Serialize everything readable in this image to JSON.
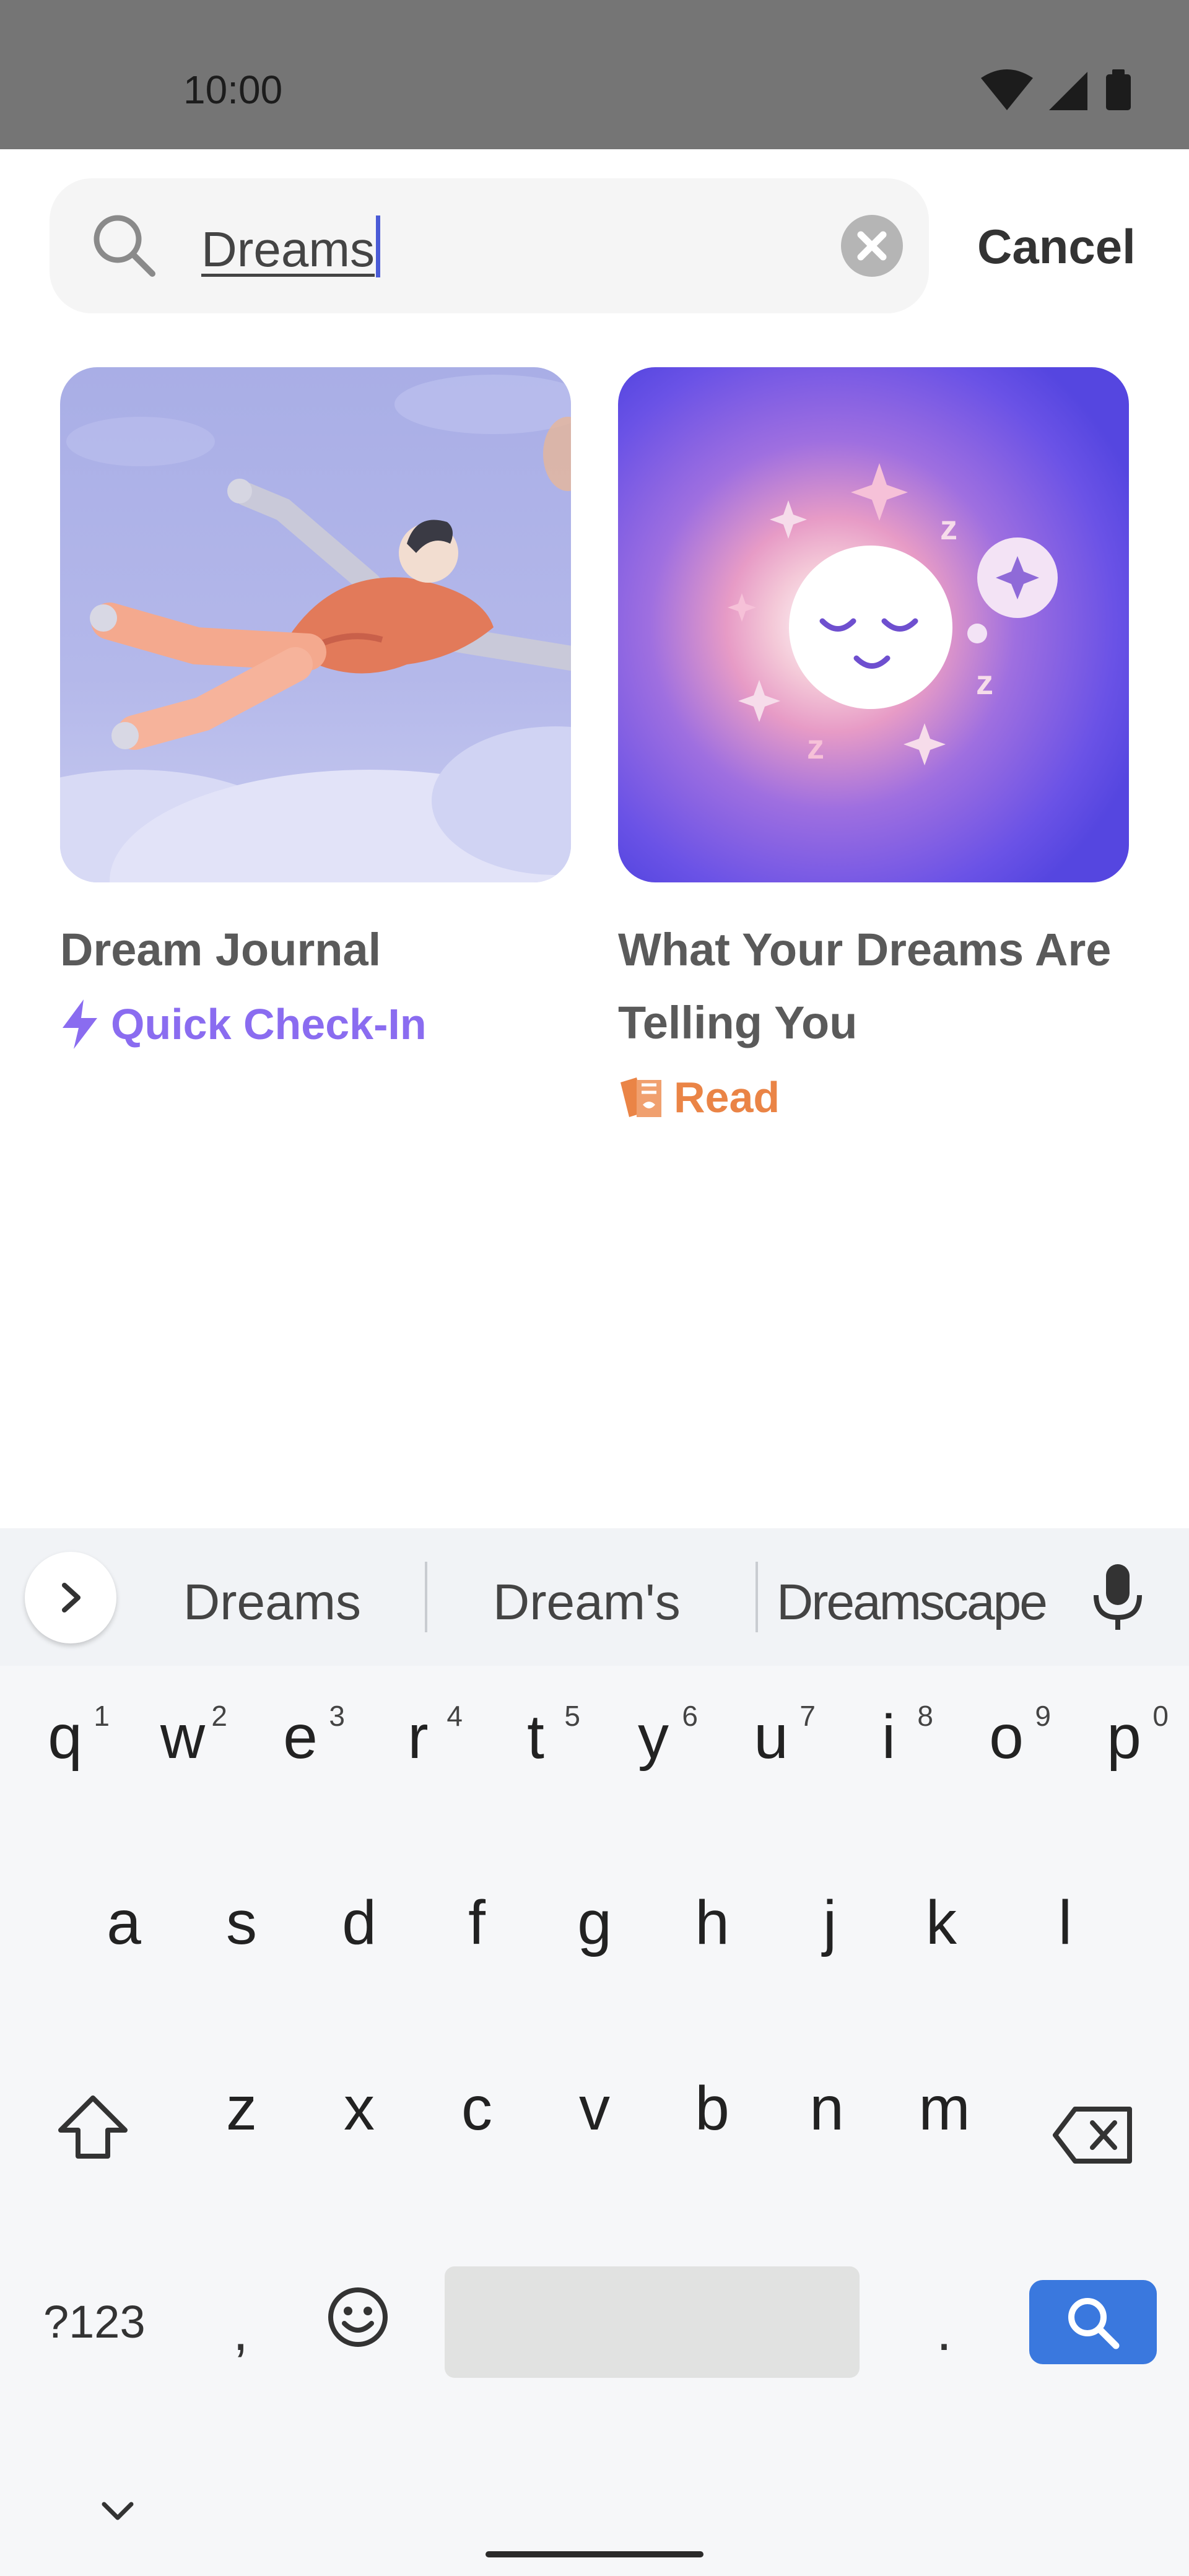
{
  "status_bar": {
    "time": "10:00"
  },
  "search": {
    "query": "Dreams",
    "cancel_label": "Cancel"
  },
  "results": [
    {
      "title": "Dream Journal",
      "tag_icon": "bolt-icon",
      "tag_label": "Quick Check-In",
      "tag_color": "#8a6cf0"
    },
    {
      "title": "What Your Dreams Are Telling You",
      "tag_icon": "books-icon",
      "tag_label": "Read",
      "tag_color": "#ea8446"
    }
  ],
  "keyboard": {
    "suggestions": [
      "Dreams",
      "Dream's",
      "Dreamscape"
    ],
    "row1": [
      {
        "key": "q",
        "hint": "1"
      },
      {
        "key": "w",
        "hint": "2"
      },
      {
        "key": "e",
        "hint": "3"
      },
      {
        "key": "r",
        "hint": "4"
      },
      {
        "key": "t",
        "hint": "5"
      },
      {
        "key": "y",
        "hint": "6"
      },
      {
        "key": "u",
        "hint": "7"
      },
      {
        "key": "i",
        "hint": "8"
      },
      {
        "key": "o",
        "hint": "9"
      },
      {
        "key": "p",
        "hint": "0"
      }
    ],
    "row2": [
      "a",
      "s",
      "d",
      "f",
      "g",
      "h",
      "j",
      "k",
      "l"
    ],
    "row3": [
      "z",
      "x",
      "c",
      "v",
      "b",
      "n",
      "m"
    ],
    "symbols_label": "?123",
    "comma_label": ",",
    "period_label": "."
  },
  "colors": {
    "accent_purple": "#8a6cf0",
    "accent_orange": "#ea8446",
    "search_key_blue": "#3a78de"
  }
}
